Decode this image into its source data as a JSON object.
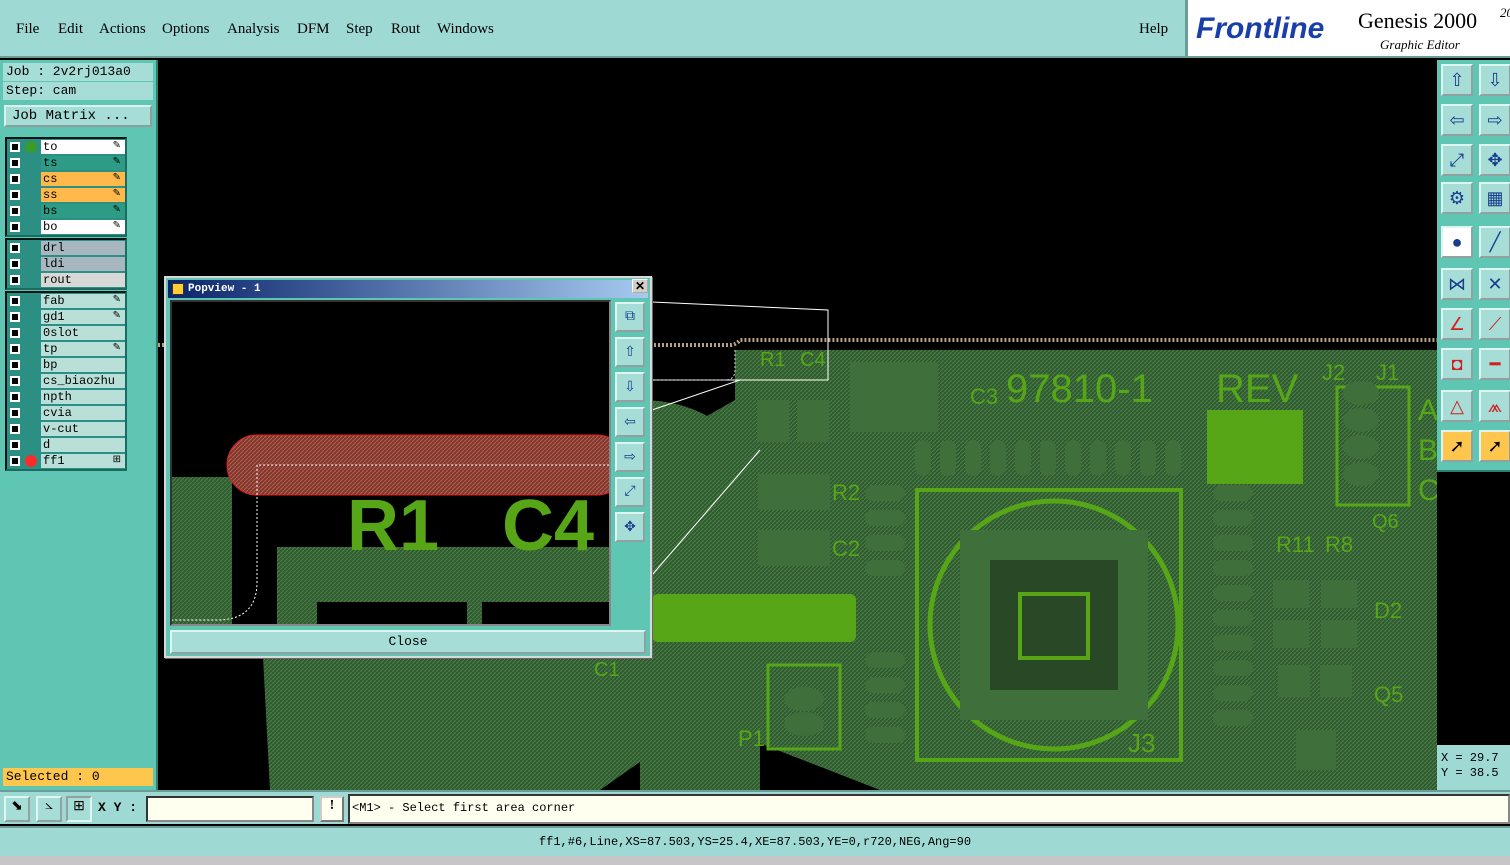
{
  "menu": [
    "File",
    "Edit",
    "Actions",
    "Options",
    "Analysis",
    "DFM",
    "Step",
    "Rout",
    "Windows"
  ],
  "help": "Help",
  "brand": {
    "logo": "Frontline",
    "product": "Genesis 2000",
    "superscript": "20",
    "subtitle": "Graphic Editor"
  },
  "job": {
    "job_line": "Job : 2v2rj013a0",
    "step_line": "Step: cam",
    "matrix_button": "Job Matrix ..."
  },
  "layers_group1": [
    {
      "name": "to",
      "color": "#ffffff",
      "dot": "#3a9a2a",
      "edit": "✎"
    },
    {
      "name": "ts",
      "color": "#2e9b86",
      "dot": "",
      "edit": "✎"
    },
    {
      "name": "cs",
      "color": "#ffb84a",
      "dot": "",
      "edit": "✎"
    },
    {
      "name": "ss",
      "color": "#ffb84a",
      "dot": "",
      "edit": "✎"
    },
    {
      "name": "bs",
      "color": "#2e9b86",
      "dot": "",
      "edit": "✎"
    },
    {
      "name": "bo",
      "color": "#ffffff",
      "dot": "",
      "edit": "✎"
    }
  ],
  "layers_group2": [
    {
      "name": "drl",
      "color": "#a8b6c0"
    },
    {
      "name": "ldi",
      "color": "#a8b6c0"
    },
    {
      "name": "rout",
      "color": "#d8d8d8"
    }
  ],
  "layers_group3": [
    {
      "name": "fab",
      "color": "#b9dfd9",
      "edit": "✎"
    },
    {
      "name": "gd1",
      "color": "#b9dfd9",
      "edit": "✎"
    },
    {
      "name": "0slot",
      "color": "#b9dfd9",
      "edit": ""
    },
    {
      "name": "tp",
      "color": "#b9dfd9",
      "edit": "✎"
    },
    {
      "name": "bp",
      "color": "#b9dfd9",
      "edit": ""
    },
    {
      "name": "cs_biaozhu",
      "color": "#b9dfd9",
      "edit": ""
    },
    {
      "name": "npth",
      "color": "#b9dfd9",
      "edit": ""
    },
    {
      "name": "cvia",
      "color": "#b9dfd9",
      "edit": ""
    },
    {
      "name": "v-cut",
      "color": "#b9dfd9",
      "edit": ""
    },
    {
      "name": "d",
      "color": "#b9dfd9",
      "edit": ""
    },
    {
      "name": "ff1",
      "color": "#b9dfd9",
      "dot": "#ff2a2a",
      "edit": "⊞"
    }
  ],
  "selected": "Selected : 0",
  "coords": {
    "x": "X = 29.7",
    "y": "Y = 38.5"
  },
  "cmd": {
    "xy_label": "X Y :",
    "xy_value": "",
    "prompt": "<M1> - Select first area corner"
  },
  "status": "ff1,#6,Line,XS=87.503,YS=25.4,XE=87.503,YE=0,r720,NEG,Ang=90",
  "popview": {
    "title": "Popview - 1",
    "close": "Close",
    "labels": [
      "R1",
      "C4"
    ]
  },
  "pcb_labels": {
    "board_no": "97810-1",
    "rev": "REV",
    "c3": "C3",
    "r1": "R1",
    "c4": "C4",
    "j2": "J2",
    "j1": "J1",
    "r2": "R2",
    "c2": "C2",
    "r11": "R11",
    "r8": "R8",
    "q6": "Q6",
    "d2": "D2",
    "q5": "Q5",
    "c1": "C1",
    "p1": "P1",
    "j3": "J3",
    "a": "A",
    "b": "B",
    "c": "C"
  }
}
